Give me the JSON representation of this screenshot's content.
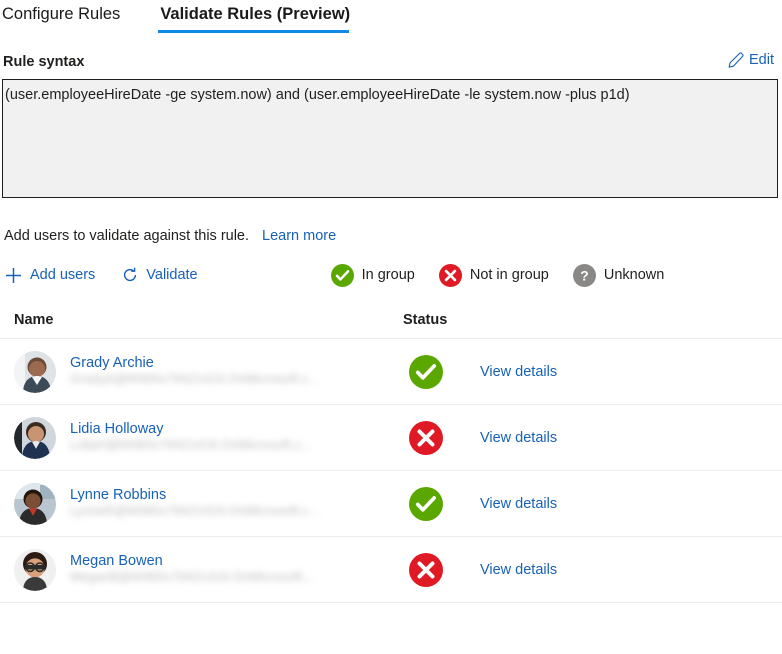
{
  "tabs": [
    {
      "label": "Configure Rules",
      "active": false
    },
    {
      "label": "Validate Rules (Preview)",
      "active": true
    }
  ],
  "rule": {
    "label": "Rule syntax",
    "edit_label": "Edit",
    "edit_icon": "pencil-icon",
    "syntax": "(user.employeeHireDate -ge system.now) and (user.employeeHireDate -le system.now -plus p1d)"
  },
  "validate": {
    "prompt": "Add users to validate against this rule.",
    "learn_more": "Learn more",
    "add_users_label": "Add users",
    "add_users_icon": "plus-icon",
    "validate_label": "Validate",
    "validate_icon": "refresh-icon"
  },
  "legend": [
    {
      "label": "In group",
      "icon": "check-circle-icon",
      "color": "#5AA700"
    },
    {
      "label": "Not in group",
      "icon": "x-circle-icon",
      "color": "#E01A25"
    },
    {
      "label": "Unknown",
      "icon": "question-circle-icon",
      "color": "#8A8886"
    }
  ],
  "table": {
    "columns": [
      "Name",
      "Status"
    ],
    "rows": [
      {
        "name": "Grady Archie",
        "email": "GradyA@M365x79421419.OnMicrosoft.c...",
        "status": "in-group",
        "status_icon": "check-circle-icon",
        "action": "View details",
        "avatar": "avatar-grady-archie"
      },
      {
        "name": "Lidia Holloway",
        "email": "LidiaH@M365x79421419.OnMicrosoft.c...",
        "status": "not-in-group",
        "status_icon": "x-circle-icon",
        "action": "View details",
        "avatar": "avatar-lidia-holloway"
      },
      {
        "name": "Lynne Robbins",
        "email": "LynneR@M365x79421419.OnMicrosoft.c...",
        "status": "in-group",
        "status_icon": "check-circle-icon",
        "action": "View details",
        "avatar": "avatar-lynne-robbins"
      },
      {
        "name": "Megan Bowen",
        "email": "MeganB@M365x79421419.OnMicrosoft...",
        "status": "not-in-group",
        "status_icon": "x-circle-icon",
        "action": "View details",
        "avatar": "avatar-megan-bowen"
      }
    ]
  },
  "colors": {
    "accent": "#0f8ae8",
    "link": "#1761b8",
    "success": "#5AA700",
    "error": "#E01A25",
    "neutral": "#8A8886"
  }
}
